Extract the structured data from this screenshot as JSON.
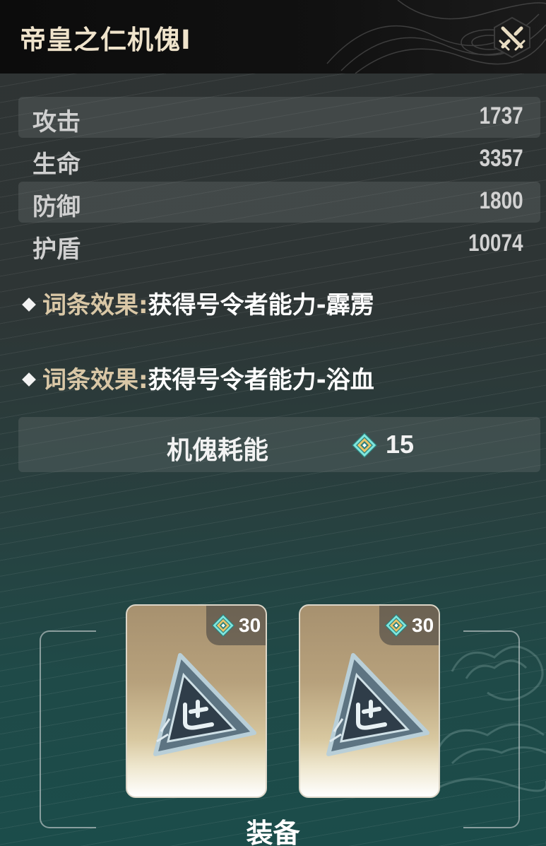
{
  "header": {
    "title": "帝皇之仁机傀I",
    "action_icon": "crossed-swords-icon"
  },
  "stats": [
    {
      "label": "攻击",
      "value": "1737"
    },
    {
      "label": "生命",
      "value": "3357"
    },
    {
      "label": "防御",
      "value": "1800"
    },
    {
      "label": "护盾",
      "value": "10074"
    }
  ],
  "effects": [
    {
      "key": "词条效果:",
      "value": "获得号令者能力-霹雳"
    },
    {
      "key": "词条效果:",
      "value": "获得号令者能力-浴血"
    }
  ],
  "cost": {
    "label": "机傀耗能",
    "value": "15",
    "icon": "energy-gem-icon"
  },
  "equip": {
    "label": "装备",
    "cards": [
      {
        "cost": "30",
        "icon": "triangle-rune-stone-icon"
      },
      {
        "cost": "30",
        "icon": "triangle-rune-stone-icon"
      }
    ]
  },
  "colors": {
    "title": "#efe3cb",
    "effect_key": "#d9c7a6",
    "gem_teal": "#5fd0c8",
    "gem_gold": "#e6c36a"
  }
}
